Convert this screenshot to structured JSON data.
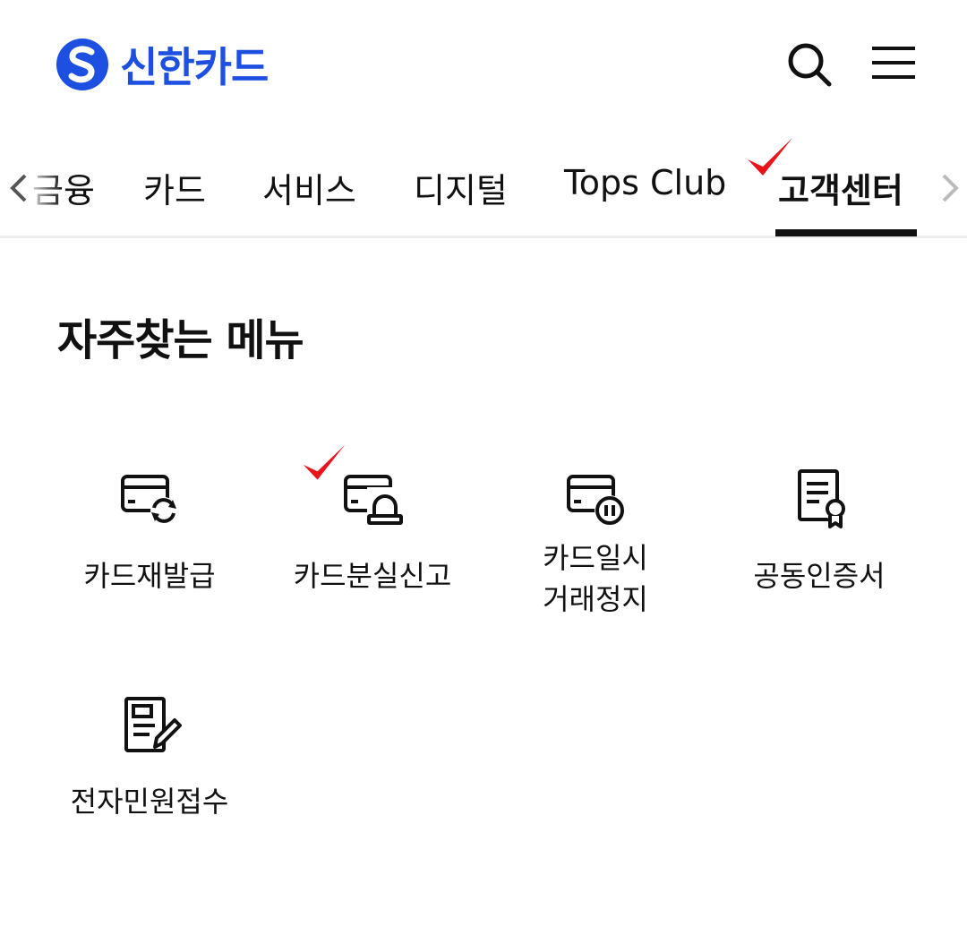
{
  "header": {
    "logo_text": "신한카드",
    "search_icon": "search-icon",
    "menu_icon": "hamburger-menu-icon"
  },
  "tabs": [
    {
      "label": "금융"
    },
    {
      "label": "카드"
    },
    {
      "label": "서비스"
    },
    {
      "label": "디지털"
    },
    {
      "label": "Tops Club"
    },
    {
      "label": "고객센터",
      "active": true
    }
  ],
  "section": {
    "title": "자주찾는 메뉴"
  },
  "menu": [
    {
      "label": "카드재발급",
      "icon": "card-reissue-icon"
    },
    {
      "label": "카드분실신고",
      "icon": "card-lost-report-icon"
    },
    {
      "label_line1": "카드일시",
      "label_line2": "거래정지",
      "icon": "card-suspend-icon"
    },
    {
      "label": "공동인증서",
      "icon": "certificate-icon"
    },
    {
      "label": "전자민원접수",
      "icon": "document-edit-icon"
    }
  ],
  "colors": {
    "brand": "#1d4fe0",
    "check": "#e8141c",
    "text": "#111111"
  }
}
